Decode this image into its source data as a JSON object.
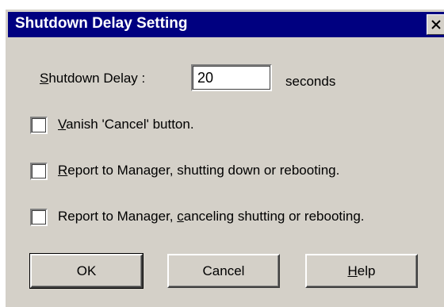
{
  "window": {
    "title": "Shutdown Delay Setting",
    "close_glyph": "✕"
  },
  "delay": {
    "label_hotkey": "S",
    "label_rest": "hutdown Delay :",
    "value": "20",
    "unit": "seconds"
  },
  "options": [
    {
      "label_hotkey": "V",
      "label_rest": "anish 'Cancel' button.",
      "checked": false
    },
    {
      "label_hotkey": "R",
      "label_rest": "eport to Manager, shutting down or rebooting.",
      "checked": false
    },
    {
      "label_prefix": "Report to Manager, ",
      "label_hotkey": "c",
      "label_rest": "anceling shutting or rebooting.",
      "checked": false
    }
  ],
  "buttons": {
    "ok": "OK",
    "cancel": "Cancel",
    "help_hotkey": "H",
    "help_rest": "elp"
  }
}
